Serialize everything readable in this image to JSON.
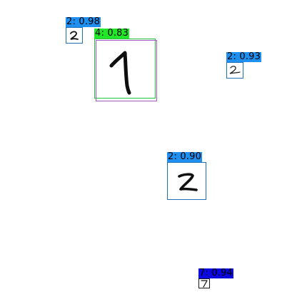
{
  "detections": [
    {
      "class": "2",
      "score": "0.98",
      "text": "2: 0.98",
      "color": "#1f8ff0"
    },
    {
      "class": "4",
      "score": "0.83",
      "text": "4: 0.83",
      "color": "#22e628"
    },
    {
      "class": "1",
      "score": "",
      "text": "",
      "color": "#a35bc4"
    },
    {
      "class": "2",
      "score": "0.93",
      "text": "2: 0.93",
      "color": "#1f8ff0"
    },
    {
      "class": "2",
      "score": "0.90",
      "text": "2: 0.90",
      "color": "#1f8ff0"
    },
    {
      "class": "7",
      "score": "0.94",
      "text": "7: 0.94",
      "color": "#0b08e0"
    }
  ]
}
